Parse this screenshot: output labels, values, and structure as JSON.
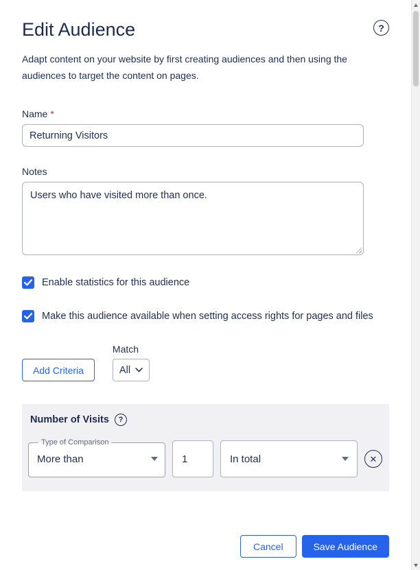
{
  "icons": {
    "help": "?",
    "close": "✕"
  },
  "header": {
    "title": "Edit Audience",
    "description": "Adapt content on your website by first creating audiences and then using the audiences to target the content on pages."
  },
  "form": {
    "name_label": "Name",
    "required_marker": "*",
    "name_value": "Returning Visitors",
    "notes_label": "Notes",
    "notes_value": "Users who have visited more than once.",
    "checkboxes": [
      {
        "label": "Enable statistics for this audience",
        "checked": true
      },
      {
        "label": "Make this audience available when setting access rights for pages and files",
        "checked": true
      }
    ],
    "add_criteria_label": "Add Criteria",
    "match_label": "Match",
    "match_value": "All"
  },
  "criterion": {
    "title": "Number of Visits",
    "comparison_label": "Type of Comparison",
    "comparison_value": "More than",
    "amount_value": "1",
    "unit_value": "In total"
  },
  "footer": {
    "cancel_label": "Cancel",
    "save_label": "Save Audience"
  },
  "colors": {
    "accent": "#2563eb",
    "heading": "#1b2a4e",
    "required": "#d32f2f",
    "panel_bg": "#f1f1f3"
  }
}
